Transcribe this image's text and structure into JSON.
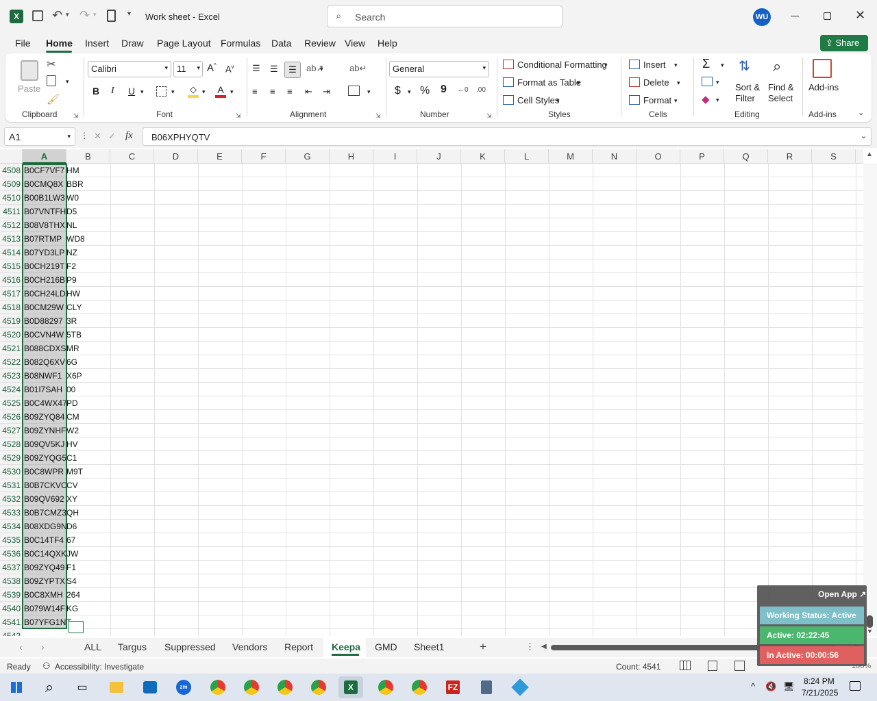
{
  "title": {
    "doc": "Work sheet",
    "app": "Excel",
    "search_placeholder": "Search",
    "avatar": "WU"
  },
  "menu": [
    "File",
    "Home",
    "Insert",
    "Draw",
    "Page Layout",
    "Formulas",
    "Data",
    "Review",
    "Help",
    "View"
  ],
  "menu_labels": {
    "file": "File",
    "home": "Home",
    "insert": "Insert",
    "draw": "Draw",
    "page_layout": "Page Layout",
    "formulas": "Formulas",
    "data": "Data",
    "review": "Review",
    "view": "View",
    "help": "Help"
  },
  "share": "Share",
  "ribbon": {
    "clipboard": {
      "label": "Clipboard",
      "paste": "Paste"
    },
    "font": {
      "label": "Font",
      "name": "Calibri",
      "size": "11",
      "bold": "B",
      "italic": "I",
      "underline": "U"
    },
    "alignment": {
      "label": "Alignment"
    },
    "number": {
      "label": "Number",
      "format": "General",
      "currency": "$",
      "percent": "%",
      "comma": "9"
    },
    "styles": {
      "label": "Styles",
      "conditional": "Conditional Formatting",
      "table": "Format as Table",
      "cell": "Cell Styles"
    },
    "cells": {
      "label": "Cells",
      "insert": "Insert",
      "delete": "Delete",
      "format": "Format"
    },
    "editing": {
      "label": "Editing",
      "sort1": "Sort &",
      "sort2": "Filter",
      "find1": "Find &",
      "find2": "Select"
    },
    "addins": {
      "label": "Add-ins",
      "btn": "Add-ins"
    }
  },
  "formula": {
    "namebox": "A1",
    "fx": "fx",
    "value": "B06XPHYQTV"
  },
  "columns": [
    "A",
    "B",
    "C",
    "D",
    "E",
    "F",
    "G",
    "H",
    "I",
    "J",
    "K",
    "L",
    "M",
    "N",
    "O",
    "P",
    "Q",
    "R",
    "S"
  ],
  "rows": [
    {
      "n": "4508",
      "a": "B0CF7VF7",
      "b": "HM"
    },
    {
      "n": "4509",
      "a": "B0CMQ8X",
      "b": "BBR"
    },
    {
      "n": "4510",
      "a": "B00B1LW3",
      "b": "W0"
    },
    {
      "n": "4511",
      "a": "B07VNTFH",
      "b": "D5"
    },
    {
      "n": "4512",
      "a": "B08V8THX",
      "b": "NL"
    },
    {
      "n": "4513",
      "a": "B07RTMP",
      "b": "WD8"
    },
    {
      "n": "4514",
      "a": "B07YD3LP",
      "b": "NZ"
    },
    {
      "n": "4515",
      "a": "B0CH219T",
      "b": "F2"
    },
    {
      "n": "4516",
      "a": "B0CH216B",
      "b": "P9"
    },
    {
      "n": "4517",
      "a": "B0CH24LD",
      "b": "HW"
    },
    {
      "n": "4518",
      "a": "B0CM29W",
      "b": "CLY"
    },
    {
      "n": "4519",
      "a": "B0D88297",
      "b": "3R"
    },
    {
      "n": "4520",
      "a": "B0CVN4W",
      "b": "5TB"
    },
    {
      "n": "4521",
      "a": "B088CDXS",
      "b": "MR"
    },
    {
      "n": "4522",
      "a": "B082Q6XV",
      "b": "6G"
    },
    {
      "n": "4523",
      "a": "B08NWF1",
      "b": "X6P"
    },
    {
      "n": "4524",
      "a": "B01I7SAH",
      "b": "00"
    },
    {
      "n": "4525",
      "a": "B0C4WX47",
      "b": "PD"
    },
    {
      "n": "4526",
      "a": "B09ZYQ84",
      "b": "CM"
    },
    {
      "n": "4527",
      "a": "B09ZYNHF",
      "b": "W2"
    },
    {
      "n": "4528",
      "a": "B09QV5KJ",
      "b": "HV"
    },
    {
      "n": "4529",
      "a": "B09ZYQG5",
      "b": "C1"
    },
    {
      "n": "4530",
      "a": "B0C8WPR",
      "b": "M9T"
    },
    {
      "n": "4531",
      "a": "B0B7CKVC",
      "b": "CV"
    },
    {
      "n": "4532",
      "a": "B09QV692",
      "b": "XY"
    },
    {
      "n": "4533",
      "a": "B0B7CMZ3",
      "b": "QH"
    },
    {
      "n": "4534",
      "a": "B08XDG9N",
      "b": "D6"
    },
    {
      "n": "4535",
      "a": "B0C14TF4",
      "b": "67"
    },
    {
      "n": "4536",
      "a": "B0C14QXK",
      "b": "JW"
    },
    {
      "n": "4537",
      "a": "B09ZYQ49",
      "b": "F1"
    },
    {
      "n": "4538",
      "a": "B09ZYPTX",
      "b": "S4"
    },
    {
      "n": "4539",
      "a": "B0C8XMH",
      "b": "264"
    },
    {
      "n": "4540",
      "a": "B079W14F",
      "b": "KG"
    },
    {
      "n": "4541",
      "a": "B07YFG1N",
      "b": "T"
    },
    {
      "n": "4542",
      "a": "",
      "b": ""
    }
  ],
  "sheets": [
    "ALL",
    "Targus",
    "Suppressed",
    "Vendors",
    "Report",
    "Keepa",
    "GMD",
    "Sheet1"
  ],
  "active_sheet": "Keepa",
  "status": {
    "ready": "Ready",
    "accessibility": "Accessibility: Investigate",
    "count": "Count: 4541",
    "zoom": "100%"
  },
  "overlay": {
    "open": "Open App",
    "status": "Working Status: Active",
    "active": "Active: 02:22:45",
    "inactive": "In Active: 00:00:56"
  },
  "clock": {
    "time": "8:24 PM",
    "date": "7/21/2025"
  },
  "colors": {
    "accent": "#1d6b3f",
    "share": "#1f7a43",
    "active_green": "#4bb66e",
    "inactive_red": "#e06060",
    "status_blue": "#7fbfc9"
  }
}
